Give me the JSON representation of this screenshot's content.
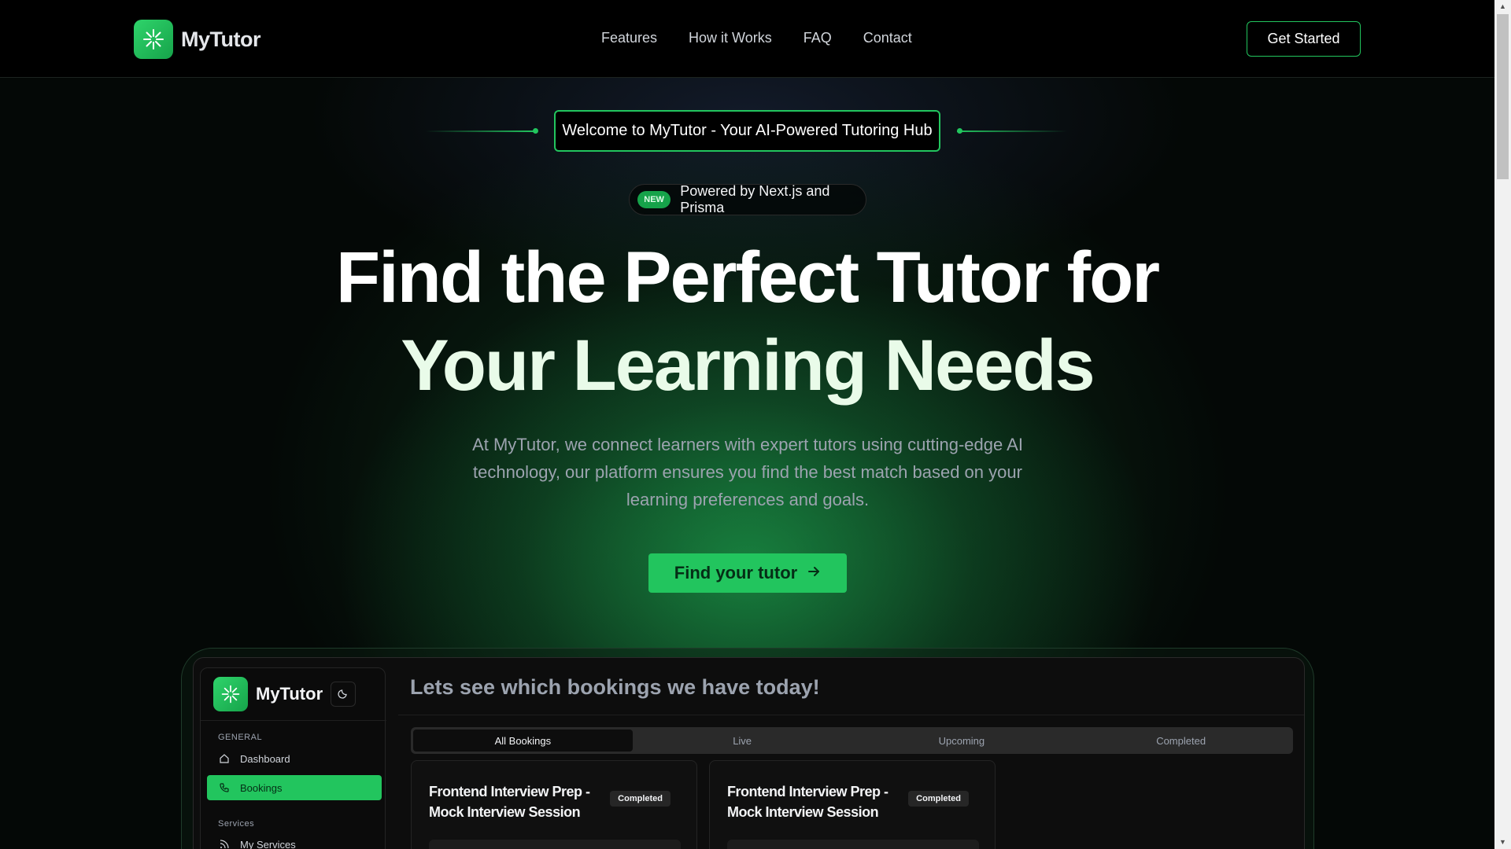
{
  "brand": {
    "name": "MyTutor",
    "accent": "#22c55e"
  },
  "nav": {
    "links": [
      "Features",
      "How it Works",
      "FAQ",
      "Contact"
    ],
    "cta": "Get Started"
  },
  "hero": {
    "welcome": "Welcome to MyTutor - Your AI-Powered Tutoring Hub",
    "badge": "NEW",
    "badge_text": "Powered by Next.js and Prisma",
    "title_line1": "Find the Perfect Tutor for",
    "title_line2": "Your Learning Needs",
    "subtitle": "At MyTutor, we connect learners with expert tutors using cutting-edge AI technology, our platform ensures you find the best match based on your learning preferences and goals.",
    "cta": "Find your tutor"
  },
  "preview": {
    "logo": "MyTutor",
    "sidebar": {
      "section_general": "GENERAL",
      "items_general": [
        {
          "label": "Dashboard",
          "icon": "home-icon"
        },
        {
          "label": "Bookings",
          "icon": "phone-icon"
        }
      ],
      "section_services": "Services",
      "items_services": [
        {
          "label": "My Services",
          "icon": "rss-icon"
        }
      ]
    },
    "title": "Lets see which bookings we have today!",
    "tabs": [
      "All Bookings",
      "Live",
      "Upcoming",
      "Completed"
    ],
    "cards": [
      {
        "title": "Frontend Interview Prep - Mock Interview Session",
        "status": "Completed"
      },
      {
        "title": "Frontend Interview Prep - Mock Interview Session",
        "status": "Completed"
      }
    ]
  }
}
